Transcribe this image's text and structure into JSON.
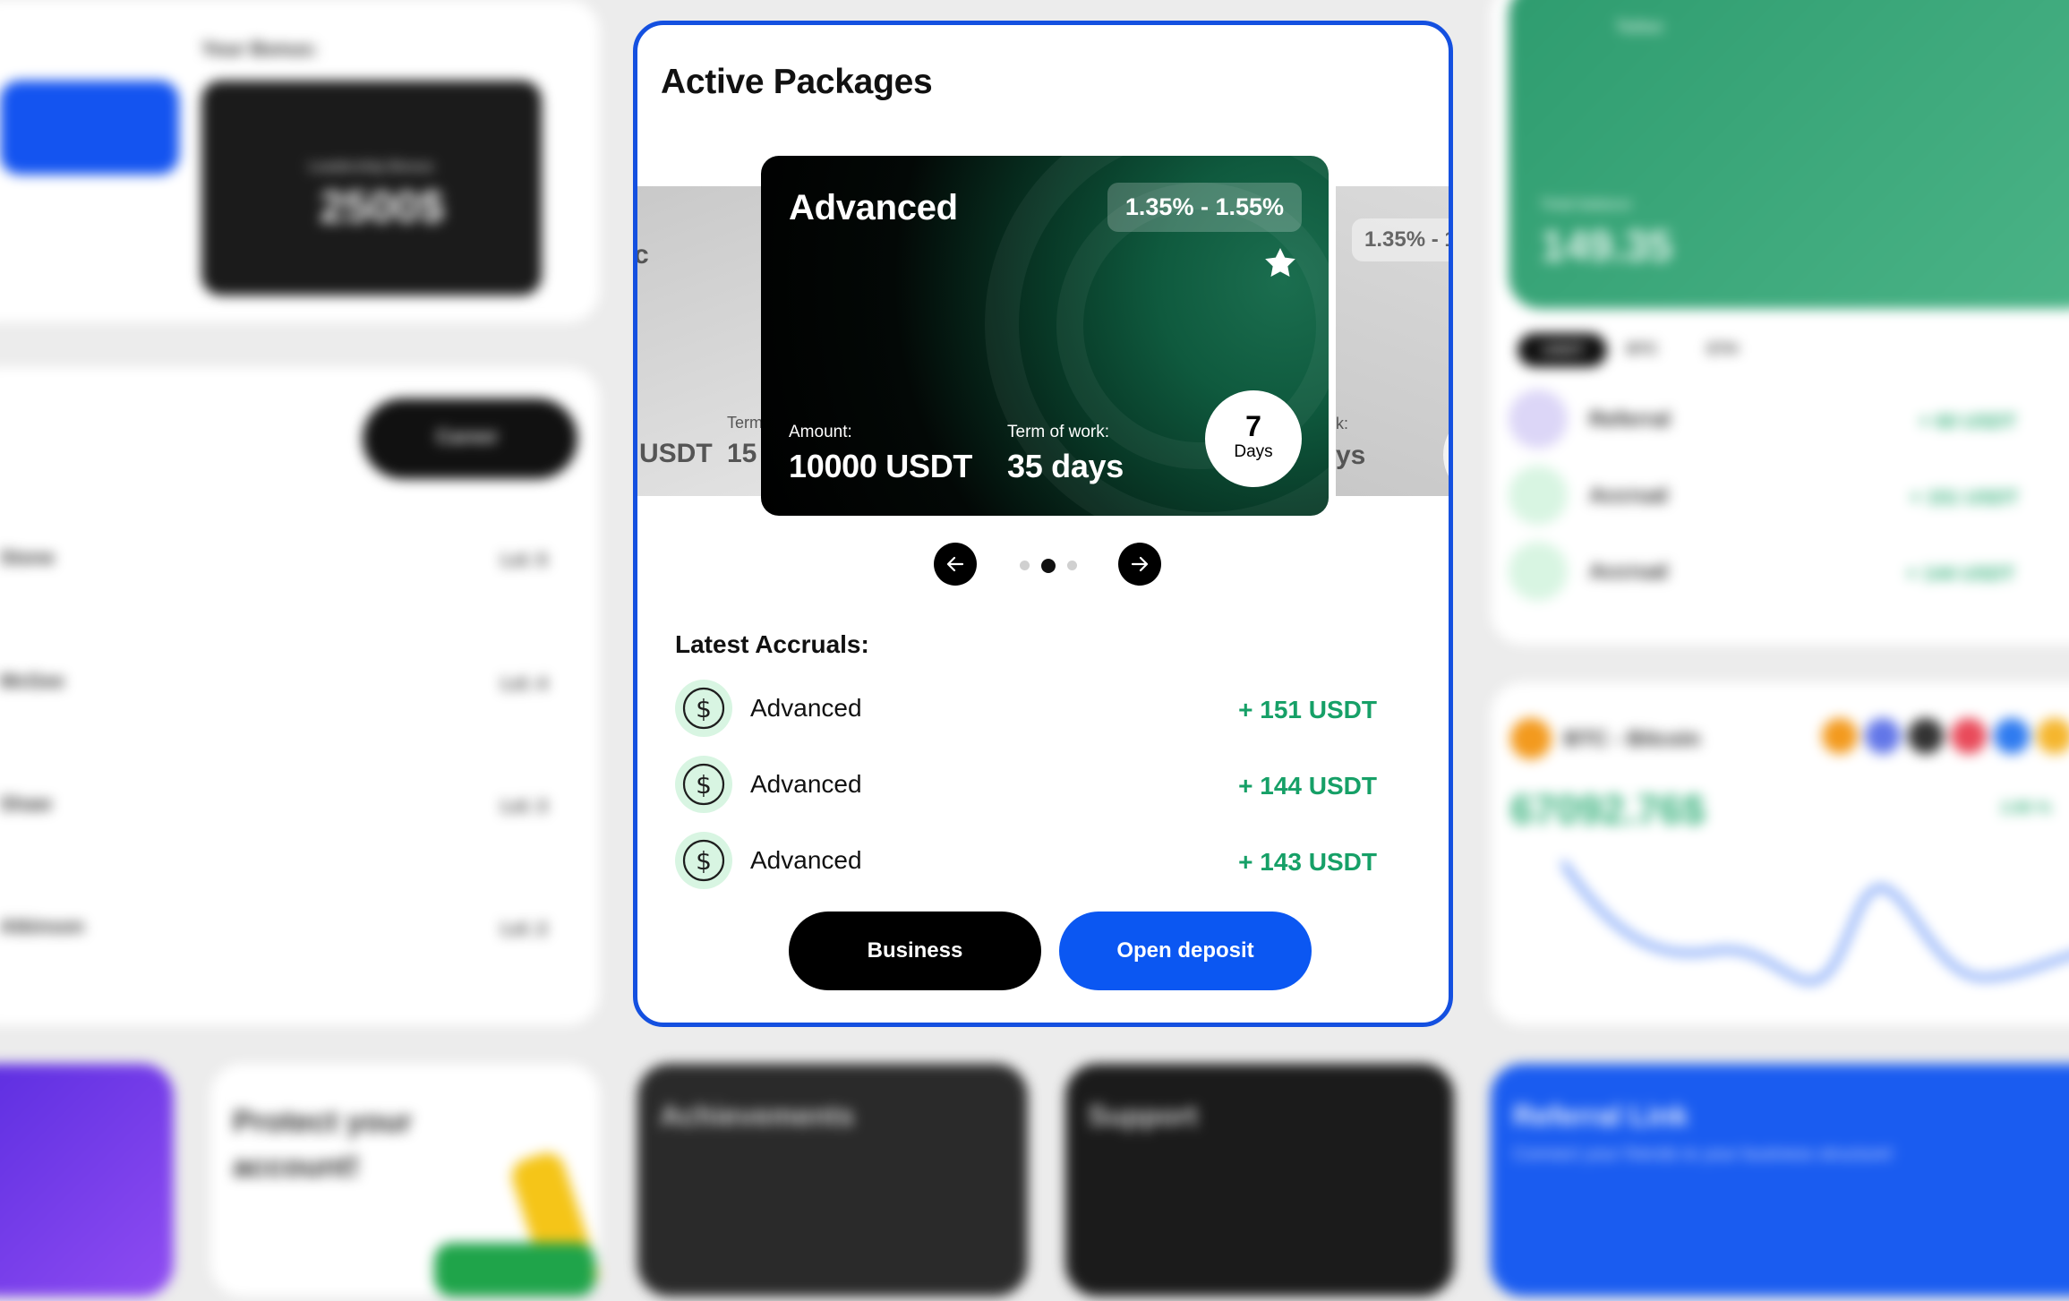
{
  "modal": {
    "title": "Active Packages",
    "package": {
      "name": "Advanced",
      "rate": "1.35% - 1.55%",
      "amount_label": "Amount:",
      "amount": "10000 USDT",
      "term_label": "Term of work:",
      "term": "35 days",
      "days_number": "7",
      "days_label": "Days"
    },
    "prev_card": {
      "term_label": "Term",
      "term_value": "15",
      "amount_tail": "USDT",
      "name_tail": "c"
    },
    "next_card": {
      "rate": "1.35% - 1",
      "term_label_tail": "k:",
      "term_tail": "ys"
    },
    "carousel": {
      "dots": 3,
      "active_index": 1
    },
    "accruals_title": "Latest Accruals:",
    "accruals": [
      {
        "name": "Advanced",
        "amount": "+ 151 USDT"
      },
      {
        "name": "Advanced",
        "amount": "+ 144 USDT"
      },
      {
        "name": "Advanced",
        "amount": "+ 143 USDT"
      }
    ],
    "buttons": {
      "business": "Business",
      "open_deposit": "Open deposit"
    }
  },
  "background": {
    "bonus_label": "Your Bonus:",
    "bonus_caption": "Leadership Bonus",
    "bonus_value": "2500$",
    "career_button": "Career",
    "team": [
      {
        "name": "Stone",
        "level": "Lvl. 5"
      },
      {
        "name": "McGee",
        "level": "Lvl. 4"
      },
      {
        "name": "Shaw",
        "level": "Lvl. 3"
      },
      {
        "name": "Atkinson",
        "level": "Lvl. 2"
      }
    ],
    "protect_title": "Protect your account!",
    "achievements_title": "Achievements",
    "support_title": "Support",
    "referral_title": "Referral Link",
    "referral_sub": "Connect your friends to your business structure!",
    "wallet": {
      "currency": "Tether",
      "balance_label": "Total balance",
      "balance": "149.35",
      "tabs": [
        "USDT",
        "BTC",
        "ETH"
      ],
      "transactions": [
        {
          "name": "Referral",
          "amount": "+ 60 USDT"
        },
        {
          "name": "Accrual",
          "amount": "+ 151 USDT"
        },
        {
          "name": "Accrual",
          "amount": "+ 144 USDT"
        }
      ]
    },
    "btc": {
      "label": "BTC - Bitcoin",
      "price": "67092.76$",
      "change": "2.85 %"
    }
  },
  "colors": {
    "accent_blue": "#0b57f2",
    "border_blue": "#1450e0",
    "accrual_green": "#16a067"
  }
}
